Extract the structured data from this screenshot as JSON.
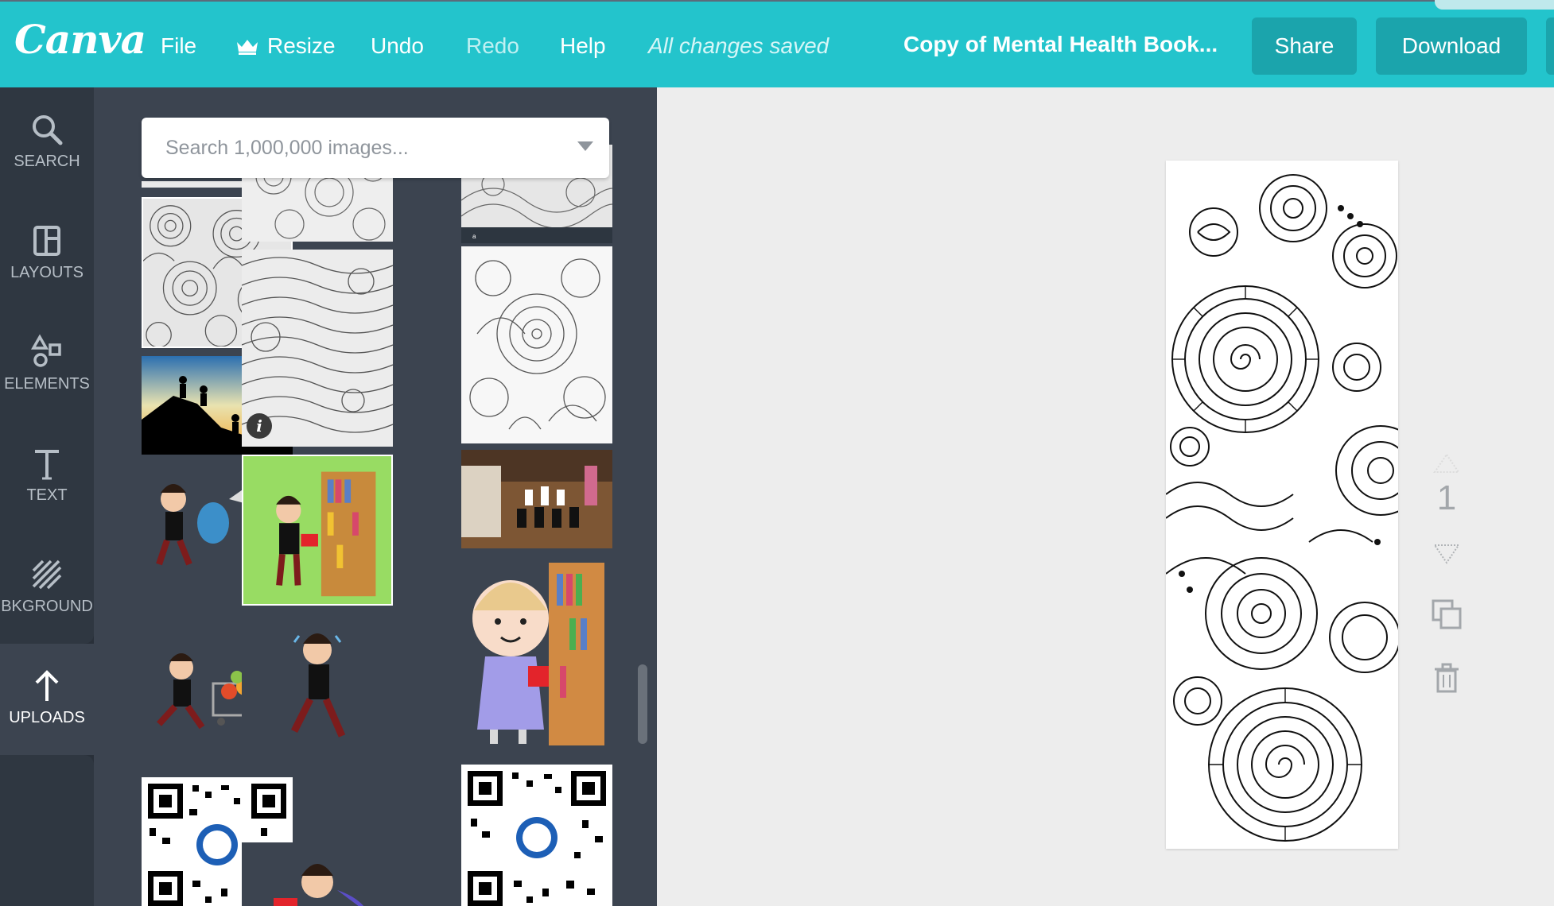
{
  "header": {
    "logo": "Canva",
    "menu": {
      "file": "File",
      "resize": "Resize",
      "undo": "Undo",
      "redo": "Redo",
      "help": "Help"
    },
    "status": "All changes saved",
    "document_title": "Copy of Mental Health Book...",
    "share_label": "Share",
    "download_label": "Download"
  },
  "toolbar": {
    "items": [
      {
        "label": "SEARCH",
        "icon": "search-icon"
      },
      {
        "label": "LAYOUTS",
        "icon": "layouts-icon"
      },
      {
        "label": "ELEMENTS",
        "icon": "elements-icon"
      },
      {
        "label": "TEXT",
        "icon": "text-icon"
      },
      {
        "label": "BKGROUND",
        "icon": "background-icon"
      },
      {
        "label": "UPLOADS",
        "icon": "upload-icon"
      }
    ],
    "active": "UPLOADS"
  },
  "panel": {
    "search_placeholder": "Search 1,000,000 images..."
  },
  "canvas": {
    "page_number": "1"
  },
  "colors": {
    "topbar": "#23c4cc",
    "button": "#1ba4ac",
    "toolbar": "#293039",
    "panel": "#3c4450",
    "canvas": "#ededed"
  }
}
